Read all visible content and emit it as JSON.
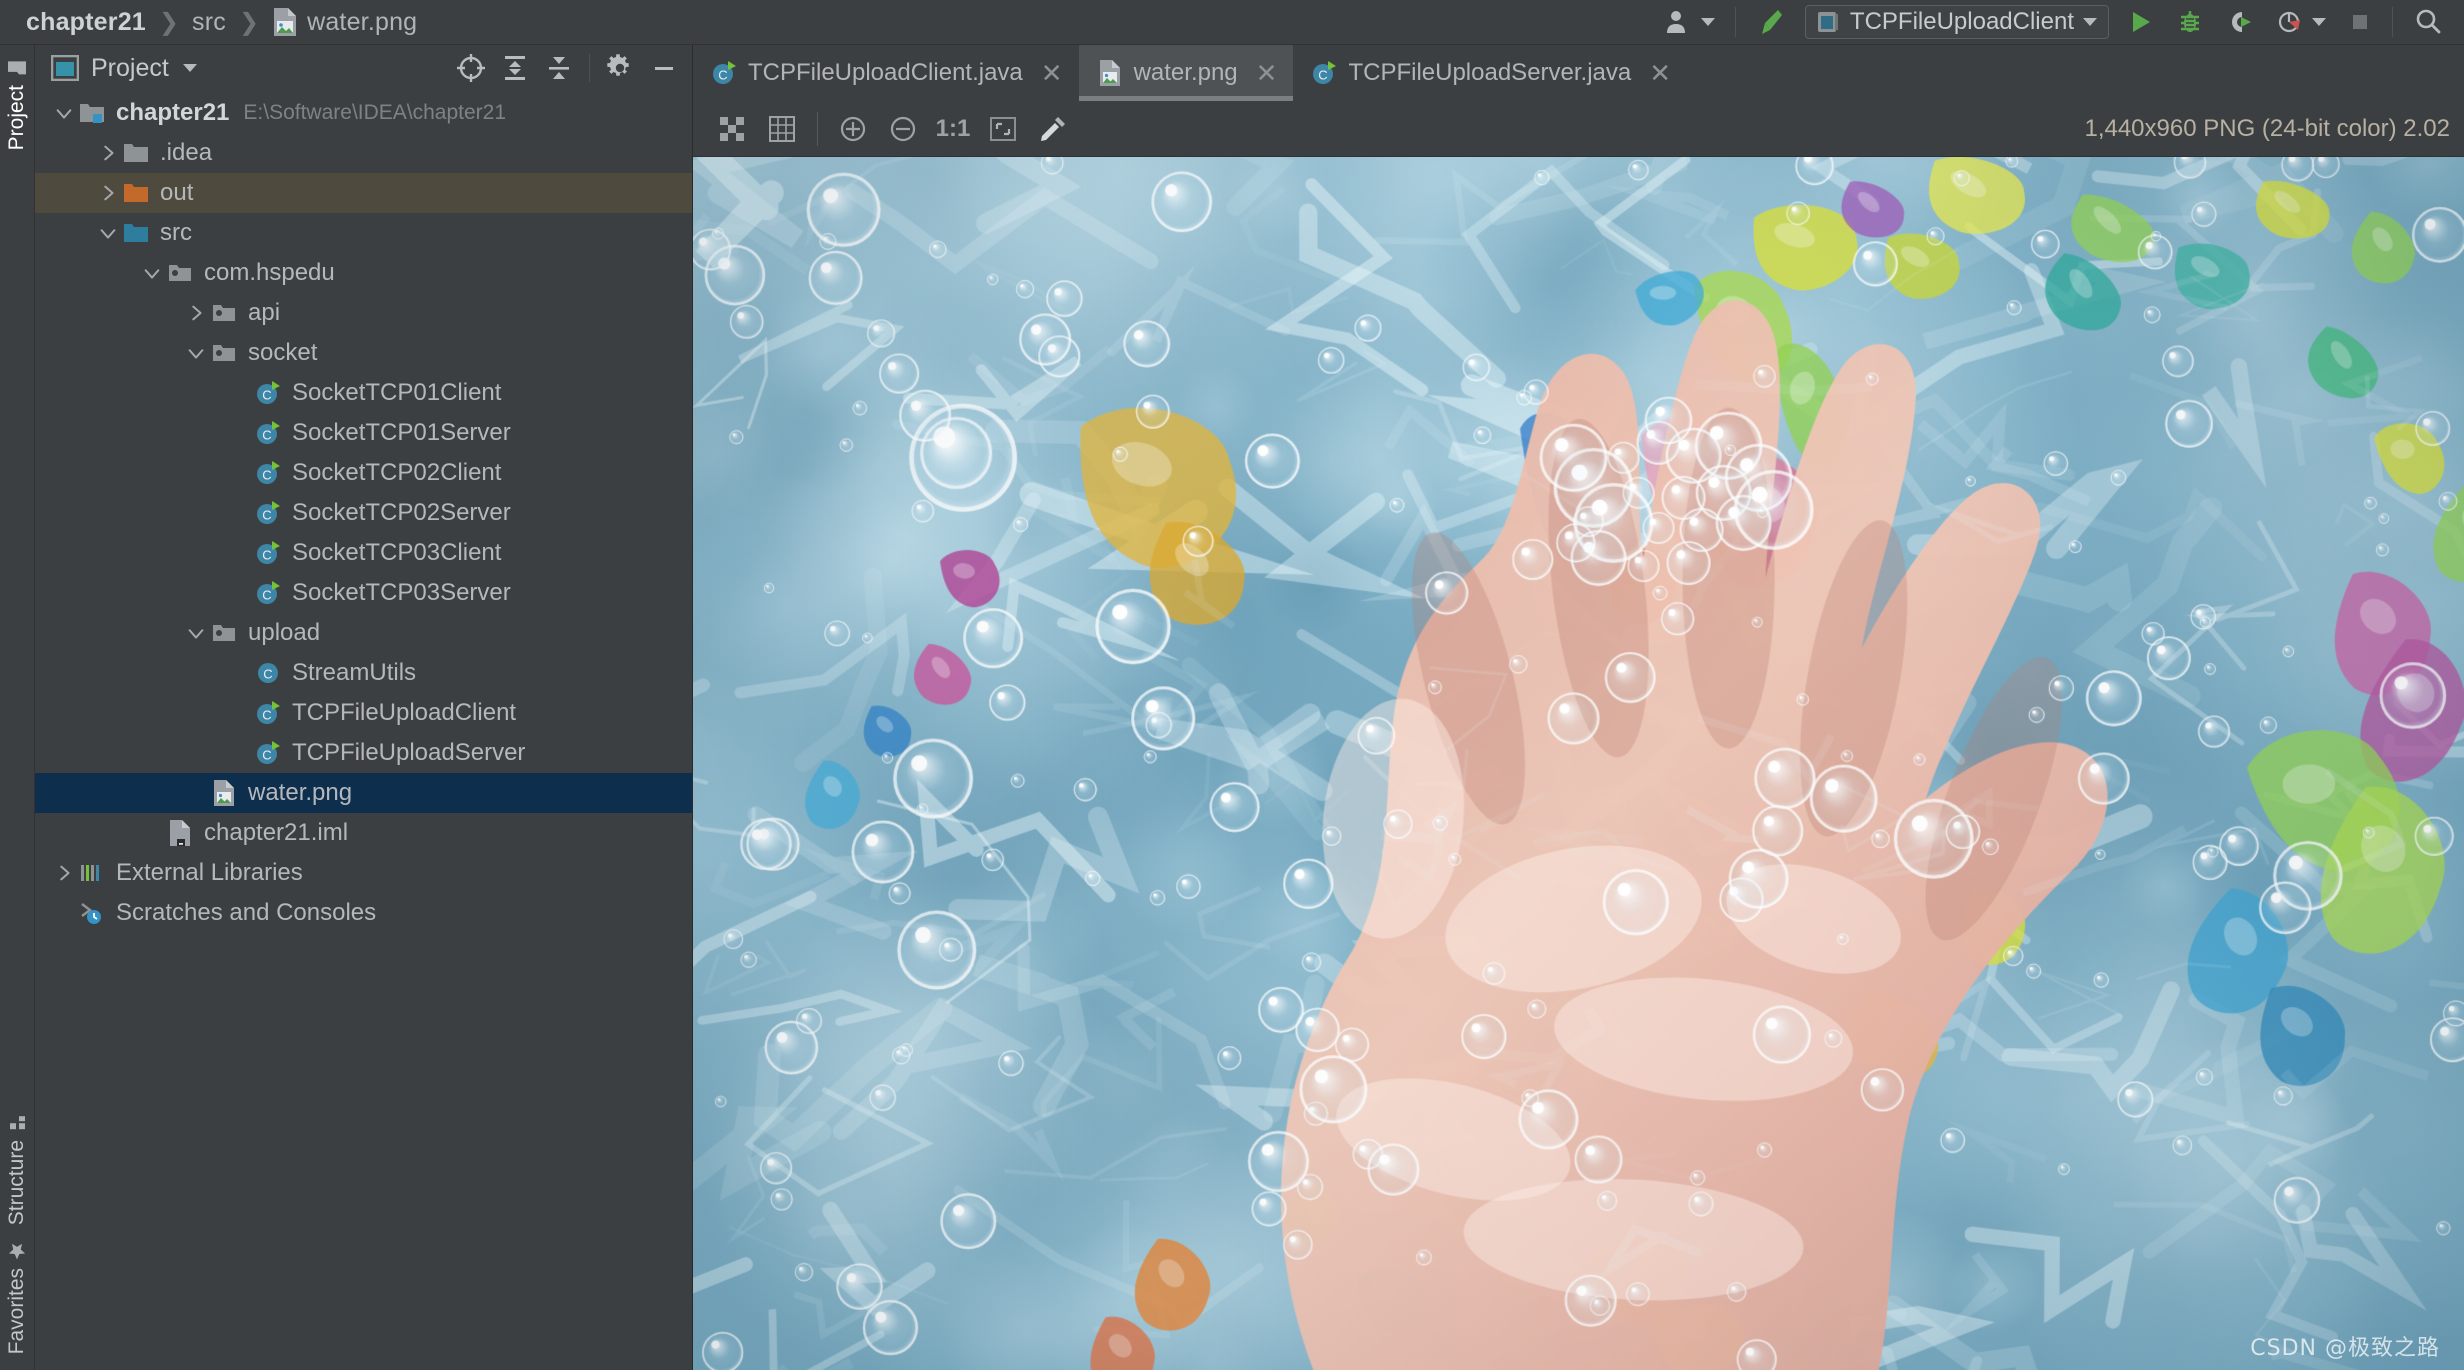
{
  "breadcrumb": {
    "items": [
      "chapter21",
      "src",
      "water.png"
    ],
    "separator": "❯",
    "file_icon": "image-file-icon"
  },
  "topbar": {
    "user_icon": "user-silhouette-icon",
    "user_caret": "chevron-down-icon",
    "build_icon": "hammer-build-icon",
    "run_config": {
      "icon": "run-config-icon",
      "label": "TCPFileUploadClient",
      "caret": "chevron-down-icon"
    },
    "actions": [
      {
        "name": "run-button",
        "icon": "play-triangle-icon",
        "color": "#5fad4e"
      },
      {
        "name": "debug-button",
        "icon": "bug-icon",
        "color": "#5fad4e"
      },
      {
        "name": "run-with-coverage-button",
        "icon": "coverage-icon",
        "color": "#5fad4e"
      },
      {
        "name": "profiler-button",
        "icon": "profiler-clock-icon",
        "color": "#c75450"
      },
      {
        "name": "profiler-dropdown",
        "icon": "chevron-down-icon",
        "color": "#b6babc"
      },
      {
        "name": "stop-button",
        "icon": "stop-square-icon",
        "color": "#6e7275"
      },
      {
        "name": "search-everywhere-button",
        "icon": "search-magnifier-icon",
        "color": "#b6babc"
      }
    ]
  },
  "rail": {
    "left_top": [
      {
        "label": "Project",
        "icon": "project-folder-icon",
        "active": true
      }
    ],
    "left_bottom": [
      {
        "label": "Structure",
        "icon": "structure-blocks-icon",
        "active": false
      },
      {
        "label": "Favorites",
        "icon": "star-icon",
        "active": false
      }
    ]
  },
  "project_panel": {
    "icon": "project-window-icon",
    "title": "Project",
    "title_caret": "chevron-down-icon",
    "tools": [
      {
        "name": "select-opened-file-button",
        "icon": "crosshair-target-icon"
      },
      {
        "name": "expand-all-button",
        "icon": "expand-all-icon"
      },
      {
        "name": "collapse-all-button",
        "icon": "collapse-all-icon"
      },
      {
        "name": "settings-button",
        "icon": "gear-icon"
      },
      {
        "name": "hide-button",
        "icon": "minimize-dash-icon"
      }
    ],
    "tree": [
      {
        "label": "chapter21",
        "sub": "E:\\Software\\IDEA\\chapter21",
        "indent": 0,
        "arrow": "down",
        "icon": "module-folder-icon",
        "bold": true,
        "state": "none"
      },
      {
        "label": ".idea",
        "sub": "",
        "indent": 1,
        "arrow": "right",
        "icon": "folder-icon",
        "bold": false,
        "state": "none"
      },
      {
        "label": "out",
        "sub": "",
        "indent": 1,
        "arrow": "right",
        "icon": "folder-orange-icon",
        "bold": false,
        "state": "hover"
      },
      {
        "label": "src",
        "sub": "",
        "indent": 1,
        "arrow": "down",
        "icon": "folder-blue-icon",
        "bold": false,
        "state": "none"
      },
      {
        "label": "com.hspedu",
        "sub": "",
        "indent": 2,
        "arrow": "down",
        "icon": "package-icon",
        "bold": false,
        "state": "none"
      },
      {
        "label": "api",
        "sub": "",
        "indent": 3,
        "arrow": "right",
        "icon": "package-icon",
        "bold": false,
        "state": "none"
      },
      {
        "label": "socket",
        "sub": "",
        "indent": 3,
        "arrow": "down",
        "icon": "package-icon",
        "bold": false,
        "state": "none"
      },
      {
        "label": "SocketTCP01Client",
        "sub": "",
        "indent": 4,
        "arrow": "none",
        "icon": "java-class-runnable-icon",
        "bold": false,
        "state": "none"
      },
      {
        "label": "SocketTCP01Server",
        "sub": "",
        "indent": 4,
        "arrow": "none",
        "icon": "java-class-runnable-icon",
        "bold": false,
        "state": "none"
      },
      {
        "label": "SocketTCP02Client",
        "sub": "",
        "indent": 4,
        "arrow": "none",
        "icon": "java-class-runnable-icon",
        "bold": false,
        "state": "none"
      },
      {
        "label": "SocketTCP02Server",
        "sub": "",
        "indent": 4,
        "arrow": "none",
        "icon": "java-class-runnable-icon",
        "bold": false,
        "state": "none"
      },
      {
        "label": "SocketTCP03Client",
        "sub": "",
        "indent": 4,
        "arrow": "none",
        "icon": "java-class-runnable-icon",
        "bold": false,
        "state": "none"
      },
      {
        "label": "SocketTCP03Server",
        "sub": "",
        "indent": 4,
        "arrow": "none",
        "icon": "java-class-runnable-icon",
        "bold": false,
        "state": "none"
      },
      {
        "label": "upload",
        "sub": "",
        "indent": 3,
        "arrow": "down",
        "icon": "package-icon",
        "bold": false,
        "state": "none"
      },
      {
        "label": "StreamUtils",
        "sub": "",
        "indent": 4,
        "arrow": "none",
        "icon": "java-class-icon",
        "bold": false,
        "state": "none"
      },
      {
        "label": "TCPFileUploadClient",
        "sub": "",
        "indent": 4,
        "arrow": "none",
        "icon": "java-class-runnable-icon",
        "bold": false,
        "state": "none"
      },
      {
        "label": "TCPFileUploadServer",
        "sub": "",
        "indent": 4,
        "arrow": "none",
        "icon": "java-class-runnable-icon",
        "bold": false,
        "state": "none"
      },
      {
        "label": "water.png",
        "sub": "",
        "indent": 3,
        "arrow": "none",
        "icon": "image-file-icon",
        "bold": false,
        "state": "selected"
      },
      {
        "label": "chapter21.iml",
        "sub": "",
        "indent": 2,
        "arrow": "none",
        "icon": "iml-file-icon",
        "bold": false,
        "state": "none"
      },
      {
        "label": "External Libraries",
        "sub": "",
        "indent": 0,
        "arrow": "right",
        "icon": "libraries-icon",
        "bold": false,
        "state": "none"
      },
      {
        "label": "Scratches and Consoles",
        "sub": "",
        "indent": 0,
        "arrow": "none",
        "icon": "scratches-icon",
        "bold": false,
        "state": "none"
      }
    ]
  },
  "editor": {
    "tabs": [
      {
        "label": "TCPFileUploadClient.java",
        "icon": "java-class-runnable-icon",
        "close": "✕",
        "active": false
      },
      {
        "label": "water.png",
        "icon": "image-file-icon",
        "close": "✕",
        "active": true
      },
      {
        "label": "TCPFileUploadServer.java",
        "icon": "java-class-runnable-icon",
        "close": "✕",
        "active": false
      }
    ],
    "image_toolbar": {
      "buttons": [
        {
          "name": "toggle-transparency-chessboard-button",
          "icon": "chessboard-icon"
        },
        {
          "name": "toggle-grid-button",
          "icon": "grid-icon"
        },
        {
          "name": "zoom-in-button",
          "icon": "zoom-in-plus-icon"
        },
        {
          "name": "zoom-out-button",
          "icon": "zoom-out-minus-icon"
        },
        {
          "name": "actual-size-button",
          "icon": "one-to-one-icon",
          "label": "1:1"
        },
        {
          "name": "fit-to-window-button",
          "icon": "fit-window-icon"
        },
        {
          "name": "color-picker-button",
          "icon": "eyedropper-icon"
        }
      ],
      "info": "1,440x960 PNG (24-bit color) 2.02"
    },
    "image": {
      "name": "water.png",
      "alt": "Underwater photo of a hand breaking the water surface surrounded by colorful confetti and bubbles",
      "watermark": "CSDN @极致之路"
    }
  },
  "colors": {
    "window_bg": "#3c3f41",
    "panel_bg": "#3c3f41",
    "tab_active_bg": "#4e5254",
    "row_selected_bg": "#0d2e4d",
    "row_hover_bg": "#4e4a3d",
    "text": "#b5b8ba",
    "text_dim": "#7e8284",
    "accent_green": "#5fad4e",
    "accent_blue": "#3592c4",
    "accent_orange": "#cc7832",
    "info_text": "#b8b0a2"
  }
}
